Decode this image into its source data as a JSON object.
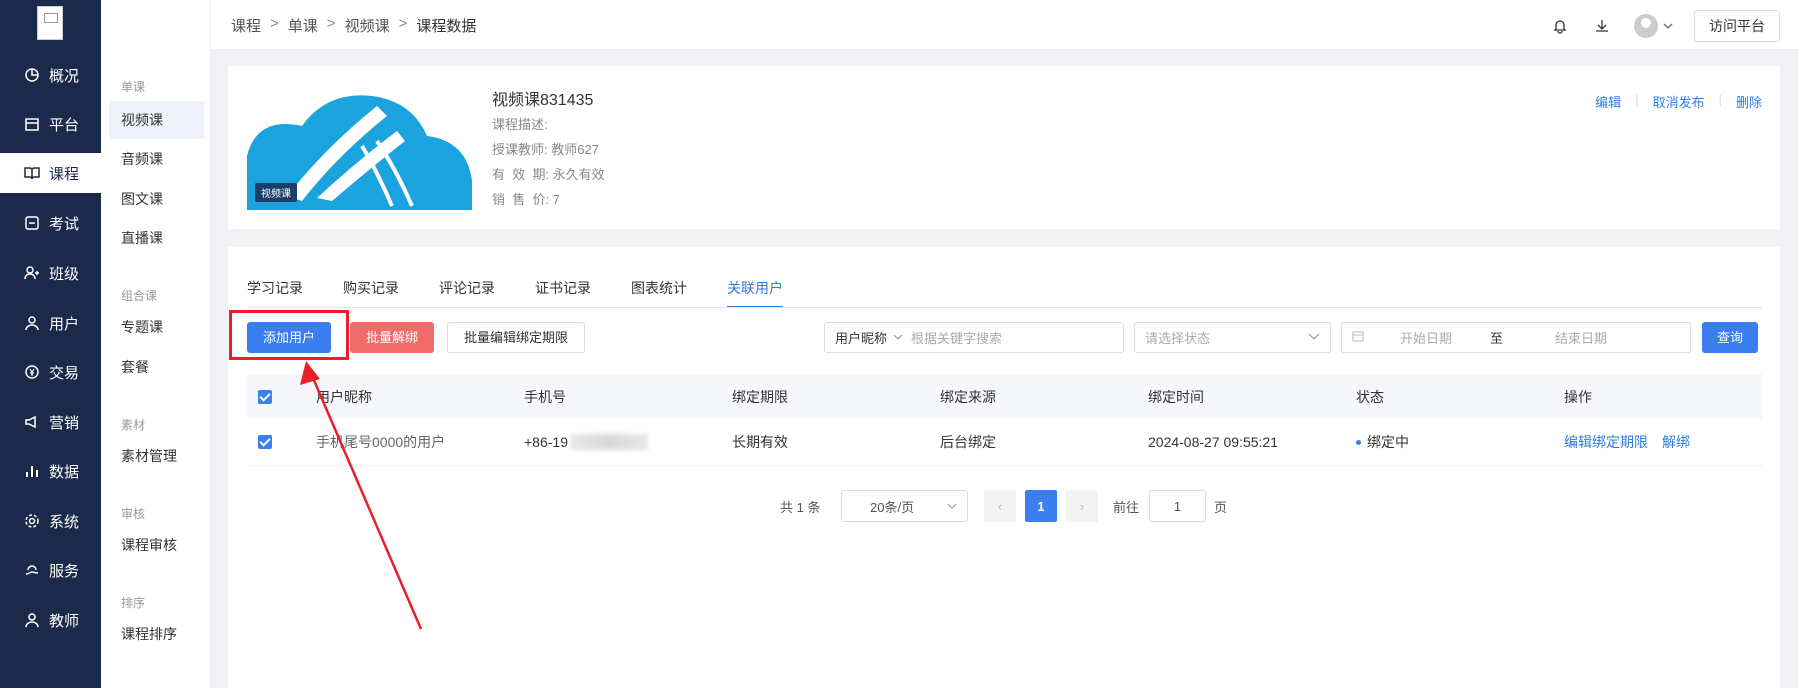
{
  "sidebar": {
    "items": [
      {
        "label": "概况",
        "icon": "pie-chart-icon"
      },
      {
        "label": "平台",
        "icon": "store-icon"
      },
      {
        "label": "课程",
        "icon": "book-icon"
      },
      {
        "label": "考试",
        "icon": "exam-icon"
      },
      {
        "label": "班级",
        "icon": "class-icon"
      },
      {
        "label": "用户",
        "icon": "user-icon"
      },
      {
        "label": "交易",
        "icon": "currency-icon"
      },
      {
        "label": "营销",
        "icon": "megaphone-icon"
      },
      {
        "label": "数据",
        "icon": "bar-chart-icon"
      },
      {
        "label": "系统",
        "icon": "gear-icon"
      },
      {
        "label": "服务",
        "icon": "service-icon"
      },
      {
        "label": "教师",
        "icon": "teacher-icon"
      }
    ]
  },
  "subnav": {
    "groups": [
      {
        "title": "单课",
        "items": [
          "视频课",
          "音频课",
          "图文课",
          "直播课"
        ]
      },
      {
        "title": "组合课",
        "items": [
          "专题课",
          "套餐"
        ]
      },
      {
        "title": "素材",
        "items": [
          "素材管理"
        ]
      },
      {
        "title": "审核",
        "items": [
          "课程审核"
        ]
      },
      {
        "title": "排序",
        "items": [
          "课程排序"
        ]
      }
    ]
  },
  "breadcrumb": [
    "课程",
    "单课",
    "视频课",
    "课程数据"
  ],
  "header": {
    "visit_label": "访问平台"
  },
  "course": {
    "title": "视频课831435",
    "desc": "课程描述:",
    "teacher": "授课教师: 教师627",
    "validity": "有  效  期: 永久有效",
    "price": "销  售  价: 7",
    "cover_tag": "视频课",
    "actions": [
      "编辑",
      "取消发布",
      "删除"
    ]
  },
  "tabs": [
    "学习记录",
    "购买记录",
    "评论记录",
    "证书记录",
    "图表统计",
    "关联用户"
  ],
  "toolbar": {
    "add_user": "添加用户",
    "batch_unbind": "批量解绑",
    "batch_edit": "批量编辑绑定期限",
    "search_type": "用户昵称",
    "search_placeholder": "根据关键字搜索",
    "status_placeholder": "请选择状态",
    "start_date": "开始日期",
    "date_sep": "至",
    "end_date": "结束日期",
    "query": "查询"
  },
  "table": {
    "headers": [
      "用户昵称",
      "手机号",
      "绑定期限",
      "绑定来源",
      "绑定时间",
      "状态",
      "操作"
    ],
    "rows": [
      {
        "nickname": "手机尾号0000的用户",
        "phone": "+86-19",
        "period": "长期有效",
        "source": "后台绑定",
        "time": "2024-08-27 09:55:21",
        "status": "绑定中",
        "op1": "编辑绑定期限",
        "op2": "解绑"
      }
    ]
  },
  "pager": {
    "total": "共 1 条",
    "size": "20条/页",
    "current": "1",
    "goto_label": "前往",
    "goto_value": "1",
    "page_suffix": "页"
  },
  "colors": {
    "accent": "#3a7ef0",
    "danger": "#f26b6b",
    "sidebar": "#1b2a4a",
    "highlight": "#e8202a"
  }
}
